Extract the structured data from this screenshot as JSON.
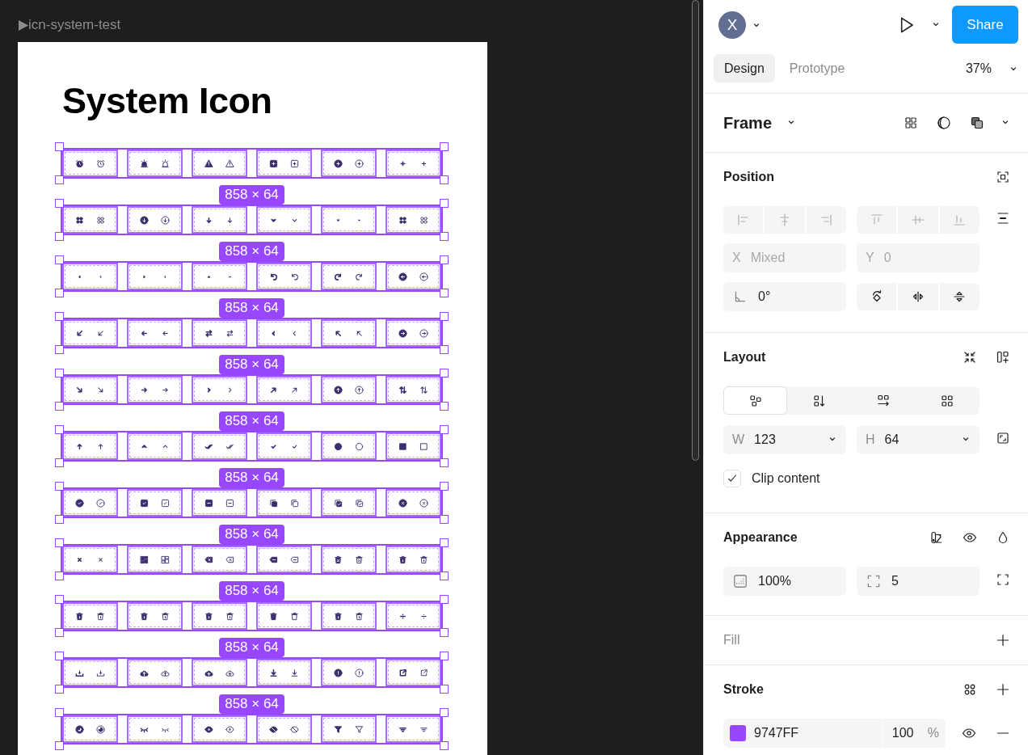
{
  "canvas": {
    "frame_label": "icn-system-test",
    "title": "System Icon",
    "icon_rows": [
      {
        "selected": true
      },
      {
        "selected": true
      },
      {
        "selected": true
      },
      {
        "selected": true
      },
      {
        "selected": true
      },
      {
        "selected": true
      },
      {
        "selected": true
      },
      {
        "selected": true
      },
      {
        "selected": true
      },
      {
        "selected": true
      },
      {
        "selected": true
      }
    ],
    "size_badges": [
      "858 × 64",
      "858 × 64",
      "858 × 64",
      "858 × 64",
      "858 × 64",
      "858 × 64",
      "858 × 64",
      "858 × 64",
      "858 × 64",
      "858 × 64"
    ]
  },
  "toolbar": {
    "avatar": "X",
    "share": "Share"
  },
  "tabs": [
    {
      "label": "Design",
      "selected": true
    },
    {
      "label": "Prototype",
      "selected": false
    }
  ],
  "zoom": "37%",
  "layer_type": "Frame",
  "position": {
    "title": "Position",
    "align_disabled": true,
    "x": {
      "label": "X",
      "value": "Mixed",
      "disabled": true
    },
    "y": {
      "label": "Y",
      "value": "0",
      "disabled": true
    },
    "rotation": "0°"
  },
  "layout": {
    "title": "Layout",
    "modes": [
      {
        "selected": true
      },
      {
        "selected": false
      },
      {
        "selected": false
      },
      {
        "selected": false
      }
    ],
    "width": {
      "label": "W",
      "value": "123"
    },
    "height": {
      "label": "H",
      "value": "64"
    },
    "clip_content": {
      "label": "Clip content",
      "checked": true
    }
  },
  "appearance": {
    "title": "Appearance",
    "opacity": "100%",
    "radius": "5"
  },
  "fill": {
    "title": "Fill",
    "empty": true
  },
  "stroke": {
    "title": "Stroke",
    "color": "#9747ff",
    "hex": "9747FF",
    "opacity": "100",
    "unit": "%"
  }
}
